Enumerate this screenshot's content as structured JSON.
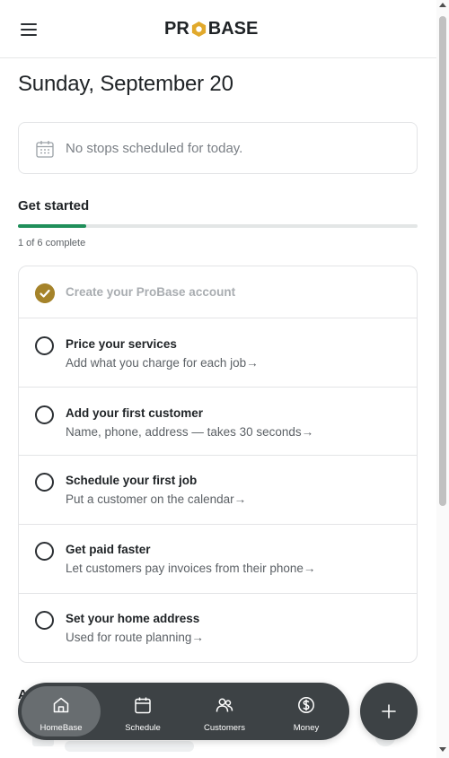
{
  "header": {
    "logo_prefix": "PR",
    "logo_suffix": "BASE"
  },
  "date_heading": "Sunday, September 20",
  "stops": {
    "message": "No stops scheduled for today."
  },
  "get_started": {
    "title": "Get started",
    "progress_text": "1 of 6 complete",
    "progress_fraction": 0.17,
    "colors": {
      "progress": "#1f8f5a",
      "check": "#a5832a"
    },
    "tasks": [
      {
        "title": "Create your ProBase account",
        "subtitle": "",
        "done": true
      },
      {
        "title": "Price your services",
        "subtitle": "Add what you charge for each job→",
        "done": false
      },
      {
        "title": "Add your first customer",
        "subtitle": "Name, phone, address — takes 30 seconds→",
        "done": false
      },
      {
        "title": "Schedule your first job",
        "subtitle": "Put a customer on the calendar→",
        "done": false
      },
      {
        "title": "Get paid faster",
        "subtitle": "Let customers pay invoices from their phone→",
        "done": false
      },
      {
        "title": "Set your home address",
        "subtitle": "Used for route planning→",
        "done": false
      }
    ]
  },
  "below_section_label": "A",
  "bottom_nav": {
    "items": [
      {
        "label": "HomeBase",
        "icon": "home-icon",
        "active": true
      },
      {
        "label": "Schedule",
        "icon": "calendar-icon",
        "active": false
      },
      {
        "label": "Customers",
        "icon": "users-icon",
        "active": false
      },
      {
        "label": "Money",
        "icon": "dollar-icon",
        "active": false
      }
    ]
  },
  "fab": {
    "icon": "plus-icon"
  }
}
